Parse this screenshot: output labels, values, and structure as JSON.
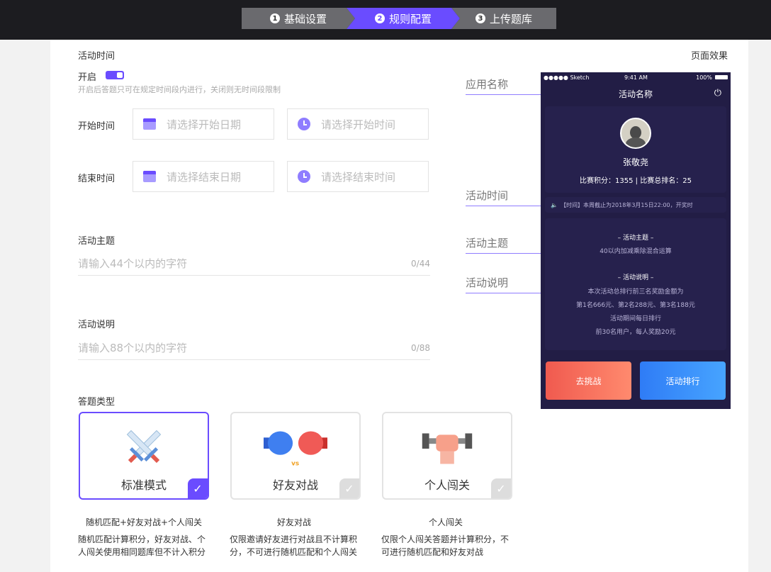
{
  "steps": [
    {
      "num": "1",
      "label": "基础设置"
    },
    {
      "num": "2",
      "label": "规则配置"
    },
    {
      "num": "3",
      "label": "上传题库"
    }
  ],
  "activity_time": {
    "section_title": "活动时间",
    "toggle_label": "开启",
    "toggle_on": true,
    "hint": "开启后答题只可在规定时间段内进行，关闭则无时间段限制",
    "start_label": "开始时间",
    "start_date_placeholder": "请选择开始日期",
    "start_time_placeholder": "请选择开始时间",
    "end_label": "结束时间",
    "end_date_placeholder": "请选择结束日期",
    "end_time_placeholder": "请选择结束时间"
  },
  "theme": {
    "label": "活动主题",
    "placeholder": "请输入44个以内的字符",
    "count": "0/44"
  },
  "description": {
    "label": "活动说明",
    "placeholder": "请输入88个以内的字符",
    "count": "0/88"
  },
  "question_type": {
    "label": "答题类型",
    "cards": [
      {
        "title": "标准模式",
        "caption": "随机匹配+好友对战+个人闯关",
        "desc": "随机匹配计算积分，好友对战、个人闯关使用相同题库但不计入积分",
        "selected": true
      },
      {
        "title": "好友对战",
        "caption": "好友对战",
        "desc": "仅限邀请好友进行对战且不计算积分，不可进行随机匹配和个人闯关",
        "selected": false
      },
      {
        "title": "个人闯关",
        "caption": "个人闯关",
        "desc": "仅限个人闯关答题并计算积分，不可进行随机匹配和好友对战",
        "selected": false
      }
    ]
  },
  "preview": {
    "heading": "页面效果",
    "annotations": [
      "应用名称",
      "活动时间",
      "活动主题",
      "活动说明"
    ],
    "status_left": "●●●●● Sketch",
    "status_time": "9:41 AM",
    "status_battery": "100%",
    "app_title": "活动名称",
    "user_name": "张敬尧",
    "score_text": "比赛积分：1355   |   比赛总排名：25",
    "notice": "【时间】本周截止为2018年3月15日22:00，开奖时",
    "theme_heading": "– 活动主题 –",
    "theme_text": "40以内加减乘除混合运算",
    "desc_heading": "– 活动说明 –",
    "desc_lines": [
      "本次活动总排行前三名奖励金额为",
      "第1名666元、第2名288元、第3名188元",
      "活动期间每日排行",
      "前30名用户，每人奖励20元"
    ],
    "btn_challenge": "去挑战",
    "btn_rank": "活动排行"
  },
  "colors": {
    "accent": "#6a4cff",
    "dark": "#1c1c20",
    "phone_bg": "#221d45"
  }
}
